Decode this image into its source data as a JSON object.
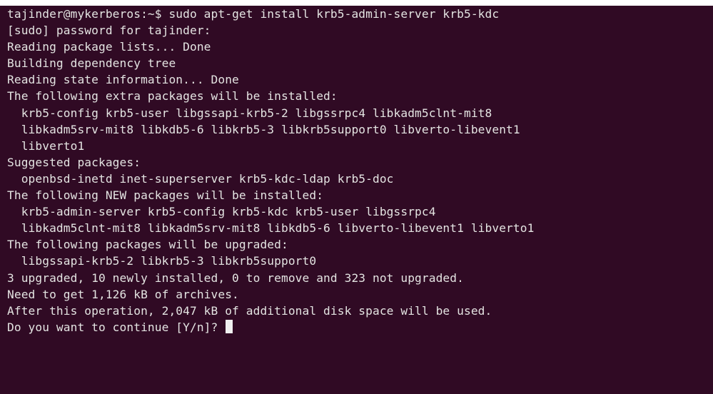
{
  "terminal": {
    "background_color": "#300a24",
    "text_color": "#e4e4e2",
    "prompt": "tajinder@mykerberos:~$ ",
    "command": "sudo apt-get install krb5-admin-server krb5-kdc",
    "output_lines": [
      "[sudo] password for tajinder:",
      "Reading package lists... Done",
      "Building dependency tree",
      "Reading state information... Done",
      "The following extra packages will be installed:",
      "  krb5-config krb5-user libgssapi-krb5-2 libgssrpc4 libkadm5clnt-mit8",
      "  libkadm5srv-mit8 libkdb5-6 libkrb5-3 libkrb5support0 libverto-libevent1",
      "  libverto1",
      "Suggested packages:",
      "  openbsd-inetd inet-superserver krb5-kdc-ldap krb5-doc",
      "The following NEW packages will be installed:",
      "  krb5-admin-server krb5-config krb5-kdc krb5-user libgssrpc4",
      "  libkadm5clnt-mit8 libkadm5srv-mit8 libkdb5-6 libverto-libevent1 libverto1",
      "The following packages will be upgraded:",
      "  libgssapi-krb5-2 libkrb5-3 libkrb5support0",
      "3 upgraded, 10 newly installed, 0 to remove and 323 not upgraded.",
      "Need to get 1,126 kB of archives.",
      "After this operation, 2,047 kB of additional disk space will be used."
    ],
    "input_prompt": "Do you want to continue [Y/n]? "
  }
}
